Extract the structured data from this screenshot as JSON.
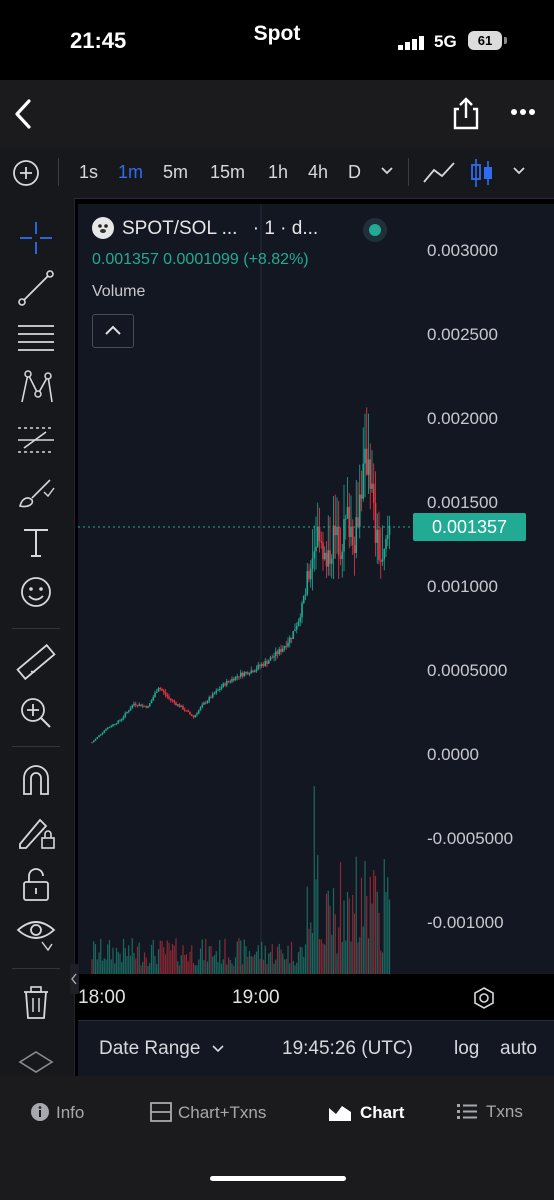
{
  "status_bar": {
    "time": "21:45",
    "network": "5G",
    "battery": "61"
  },
  "nav": {
    "title": "Spot",
    "back_icon": "chevron-left-icon",
    "share_icon": "share-icon",
    "more_icon": "more-icon"
  },
  "toolbar": {
    "timeframes": [
      "1s",
      "1m",
      "5m",
      "15m",
      "1h",
      "4h",
      "D"
    ],
    "active_timeframe": "1m"
  },
  "chart": {
    "legend_title": "SPOT/SOL ...",
    "legend_interval": "· 1 · d...",
    "legend_values": "0.001357  0.0001099 (+8.82%)",
    "volume_label": "Volume",
    "y_ticks": [
      "0.003000",
      "0.002500",
      "0.002000",
      "0.001500",
      "0.001000",
      "0.0005000",
      "0.0000",
      "-0.0005000",
      "-0.001000"
    ],
    "price_tag": "0.001357",
    "x_ticks": [
      "18:00",
      "19:00"
    ],
    "colors": {
      "up": "#22ab94",
      "down": "#f23645",
      "background": "#131722",
      "accent": "#2f6df0"
    }
  },
  "chart_data": {
    "type": "candlestick",
    "symbol": "SPOT/SOL",
    "interval": "1m",
    "last_price": 0.001357,
    "change": 0.0001099,
    "change_percent": 8.82,
    "ylim": [
      -0.001,
      0.003
    ],
    "x_time_ticks": [
      "18:00",
      "19:00"
    ],
    "close_path": [
      [
        0,
        7e-05
      ],
      [
        8,
        0.00015
      ],
      [
        16,
        0.0002
      ],
      [
        24,
        0.0003
      ],
      [
        32,
        0.00028
      ],
      [
        38,
        0.0004
      ],
      [
        44,
        0.00033
      ],
      [
        52,
        0.00027
      ],
      [
        58,
        0.00022
      ],
      [
        64,
        0.0003
      ],
      [
        70,
        0.00036
      ],
      [
        76,
        0.00042
      ],
      [
        84,
        0.00047
      ],
      [
        92,
        0.0005
      ],
      [
        100,
        0.00055
      ],
      [
        108,
        0.00062
      ],
      [
        114,
        0.0007
      ],
      [
        118,
        0.0008
      ],
      [
        122,
        0.00095
      ],
      [
        126,
        0.0012
      ],
      [
        130,
        0.00135
      ],
      [
        134,
        0.0011
      ],
      [
        138,
        0.0013
      ],
      [
        142,
        0.00125
      ],
      [
        146,
        0.0014
      ],
      [
        150,
        0.0013
      ],
      [
        154,
        0.0016
      ],
      [
        158,
        0.0018
      ],
      [
        162,
        0.0013
      ],
      [
        166,
        0.0011
      ],
      [
        170,
        0.00136
      ]
    ]
  },
  "date_range": {
    "label": "Date Range",
    "clock": "19:45:26 (UTC)",
    "log": "log",
    "auto": "auto"
  },
  "tabs": [
    {
      "label": "Info"
    },
    {
      "label": "Chart+Txns"
    },
    {
      "label": "Chart"
    },
    {
      "label": "Txns"
    }
  ]
}
